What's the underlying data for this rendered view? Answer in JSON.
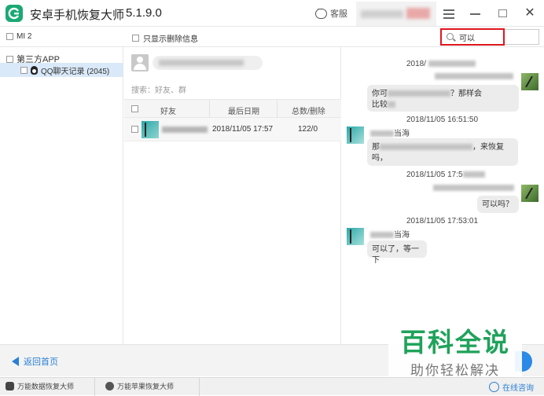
{
  "app": {
    "title": "安卓手机恢复大师",
    "version": "5.1.9.0"
  },
  "titlebar": {
    "support_label": "客服"
  },
  "device": {
    "name": "MI 2"
  },
  "options": {
    "deleted_only_label": "只显示删除信息"
  },
  "search": {
    "value": "可以"
  },
  "tree": {
    "root_label": "第三方APP",
    "child_label": "QQ聊天记录 (2045)"
  },
  "contacts": {
    "filter_placeholder": "搜索：好友、群",
    "columns": [
      "好友",
      "最后日期",
      "总数/删除"
    ],
    "rows": [
      {
        "date": "2018/11/05 17:57",
        "count": "122/0"
      }
    ]
  },
  "chat": {
    "messages": [
      {
        "timestamp": "2018/",
        "side": "right",
        "text_a": "你可",
        "text_b": "？那样会",
        "text_c": "比较",
        "text_d": ""
      },
      {
        "timestamp": "2018/11/05 16:51:50",
        "side": "left",
        "sender_tail": "当海",
        "text_a": "那",
        "text_b": "，来恢复",
        "text_c": "吗，",
        "text_d": ""
      },
      {
        "timestamp": "2018/11/05 17:5",
        "side": "right",
        "text_a": "可以吗？",
        "text_b": "",
        "text_c": "",
        "text_d": ""
      },
      {
        "timestamp": "2018/11/05 17:53:01",
        "side": "left",
        "sender_tail": "当海",
        "text_a": "可以了，等一下",
        "text_b": "",
        "text_c": "",
        "text_d": ""
      }
    ]
  },
  "bottom": {
    "back_label": "返回首页"
  },
  "watermark": {
    "title": "百科全说",
    "subtitle": "助你轻松解决"
  },
  "footer": {
    "items": [
      "万能数据恢复大师",
      "万能苹果恢复大师"
    ],
    "online_label": "在线咨询"
  },
  "colors": {
    "brand": "#1aa974",
    "accent": "#2a7fd4",
    "highlight": "#e0161d"
  }
}
